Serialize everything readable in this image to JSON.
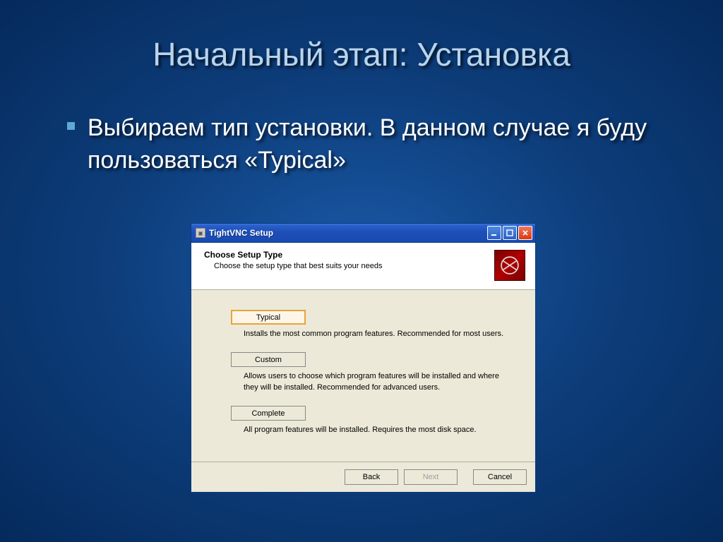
{
  "slide": {
    "title": "Начальный этап: Установка",
    "bullet_text": "Выбираем тип установки. В данном случае я буду пользоваться «Typical»"
  },
  "installer": {
    "window_title": "TightVNC Setup",
    "header": {
      "title": "Choose Setup Type",
      "subtitle": "Choose the setup type that best suits your needs"
    },
    "options": [
      {
        "label": "Typical",
        "description": "Installs the most common program features. Recommended for most users.",
        "active": true
      },
      {
        "label": "Custom",
        "description": "Allows users to choose which program features will be installed and where they will be installed. Recommended for advanced users.",
        "active": false
      },
      {
        "label": "Complete",
        "description": "All program features will be installed. Requires the most disk space.",
        "active": false
      }
    ],
    "buttons": {
      "back": "Back",
      "next": "Next",
      "cancel": "Cancel"
    }
  }
}
